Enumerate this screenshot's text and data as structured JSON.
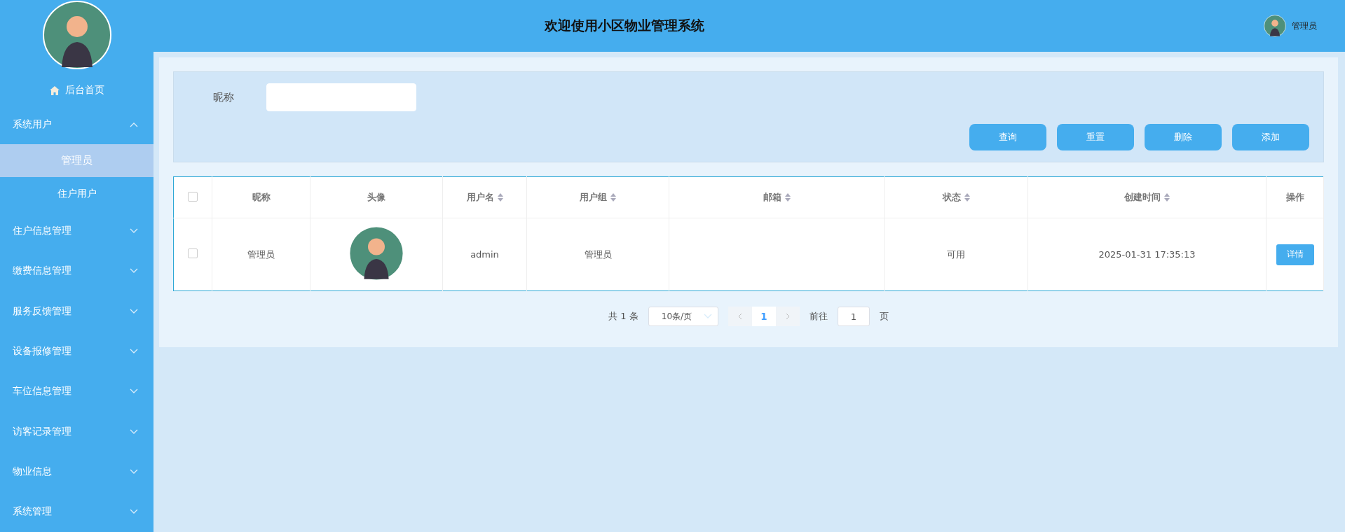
{
  "sidebar": {
    "home": "后台首页",
    "menus": [
      {
        "label": "系统用户",
        "expanded": true,
        "children": [
          {
            "label": "管理员",
            "selected": true
          },
          {
            "label": "住户用户",
            "selected": false
          }
        ]
      },
      {
        "label": "住户信息管理",
        "expanded": false
      },
      {
        "label": "缴费信息管理",
        "expanded": false
      },
      {
        "label": "服务反馈管理",
        "expanded": false
      },
      {
        "label": "设备报修管理",
        "expanded": false
      },
      {
        "label": "车位信息管理",
        "expanded": false
      },
      {
        "label": "访客记录管理",
        "expanded": false
      },
      {
        "label": "物业信息",
        "expanded": false
      },
      {
        "label": "系统管理",
        "expanded": false
      }
    ]
  },
  "header": {
    "title": "欢迎使用小区物业管理系统",
    "user": "管理员"
  },
  "search": {
    "label": "昵称",
    "buttons": [
      "查询",
      "重置",
      "删除",
      "添加"
    ]
  },
  "table": {
    "select_all_checked": false,
    "columns": [
      {
        "label": "昵称",
        "sortable": false
      },
      {
        "label": "头像",
        "sortable": false
      },
      {
        "label": "用户名",
        "sortable": true
      },
      {
        "label": "用户组",
        "sortable": true
      },
      {
        "label": "邮箱",
        "sortable": true
      },
      {
        "label": "状态",
        "sortable": true
      },
      {
        "label": "创建时间",
        "sortable": true
      },
      {
        "label": "操作",
        "sortable": false
      }
    ],
    "rows": [
      {
        "checked": false,
        "nickname": "管理员",
        "username": "admin",
        "group": "管理员",
        "status": "可用",
        "created": "2025-01-31 17:35:13",
        "action": "详情"
      }
    ]
  },
  "pagination": {
    "total": "共 1 条",
    "page_size": "10条/页",
    "pages": [
      {
        "label": "1",
        "selected": true
      }
    ],
    "goto_label": "前往",
    "goto_value": "1",
    "goto_suffix": "页"
  }
}
